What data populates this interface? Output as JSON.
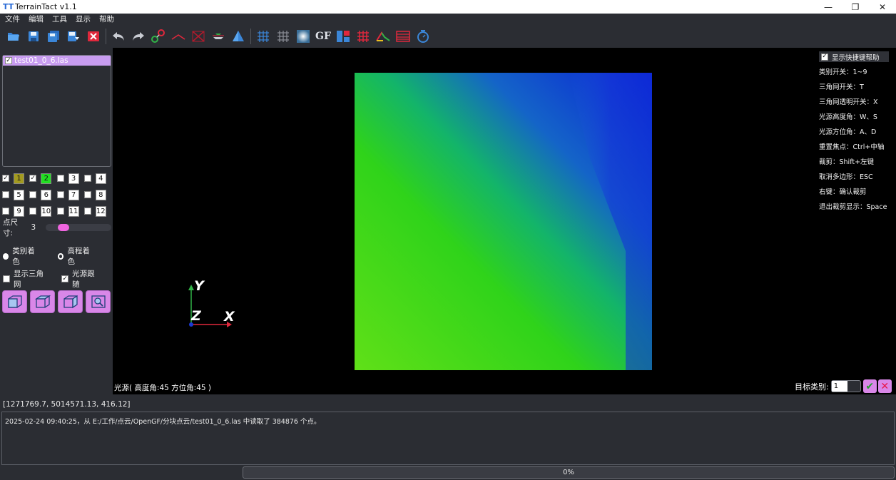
{
  "window": {
    "title": "TerrainTact v1.1",
    "app_icon": "TT"
  },
  "menu": [
    "文件",
    "编辑",
    "工具",
    "显示",
    "帮助"
  ],
  "toolbar": {
    "icons": [
      "open-folder-icon",
      "save-icon",
      "save-as-icon",
      "export-icon",
      "close-file-icon",
      "undo-icon",
      "redo-icon",
      "measure-icon",
      "angle-icon",
      "clear-icon",
      "plane-icon",
      "triangle-icon",
      "grid-icon",
      "filter-icon",
      "render-icon",
      "gf-icon",
      "classify-icon",
      "segment-icon",
      "profile-icon",
      "layers-icon",
      "target-icon"
    ],
    "gf_label": "GF"
  },
  "file_list": {
    "items": [
      {
        "name": "test01_0_6.las",
        "checked": true
      }
    ]
  },
  "classes": [
    {
      "n": "1",
      "checked": true,
      "color": "#a39a1f"
    },
    {
      "n": "2",
      "checked": true,
      "color": "#22e022"
    },
    {
      "n": "3",
      "checked": false,
      "color": "#ffffff"
    },
    {
      "n": "4",
      "checked": false,
      "color": "#ffffff"
    },
    {
      "n": "5",
      "checked": false,
      "color": "#ffffff"
    },
    {
      "n": "6",
      "checked": false,
      "color": "#ffffff"
    },
    {
      "n": "7",
      "checked": false,
      "color": "#ffffff"
    },
    {
      "n": "8",
      "checked": false,
      "color": "#ffffff"
    },
    {
      "n": "9",
      "checked": false,
      "color": "#ffffff"
    },
    {
      "n": "10",
      "checked": false,
      "color": "#ffffff"
    },
    {
      "n": "11",
      "checked": false,
      "color": "#ffffff"
    },
    {
      "n": "12",
      "checked": false,
      "color": "#ffffff"
    }
  ],
  "point_size": {
    "label": "点尺寸:",
    "value": "3"
  },
  "coloring": {
    "by_class": "类别着色",
    "by_elevation": "高程着色"
  },
  "options": {
    "show_tin": "显示三角网",
    "light_follow": "光源跟随"
  },
  "viewport": {
    "axes": {
      "x": "X",
      "y": "Y",
      "z": "Z"
    },
    "status": "光源( 高度角:45 方位角:45 )",
    "help_toggle": "显示快捷键帮助",
    "help_lines": [
      "类别开关：1~9",
      "三角网开关：T",
      "三角网透明开关：X",
      "光源高度角：W、S",
      "光源方位角：A、D",
      "重置焦点：Ctrl+中轴",
      "裁剪：Shift+左键",
      "取消多边形：ESC",
      "右键：确认裁剪",
      "退出裁剪显示：Space"
    ],
    "target_label": "目标类别:",
    "target_value": "1"
  },
  "coords": "[1271769.7, 5014571.13, 416.12]",
  "log": "2025-02-24 09:40:25，从 E:/工作/点云/OpenGF/分块点云/test01_0_6.las 中读取了 384876 个点。",
  "progress": {
    "value": 0,
    "text": "0%"
  },
  "colors": {
    "background": "#2b2d33",
    "accent": "#d987e8",
    "viewport": "#000000"
  }
}
